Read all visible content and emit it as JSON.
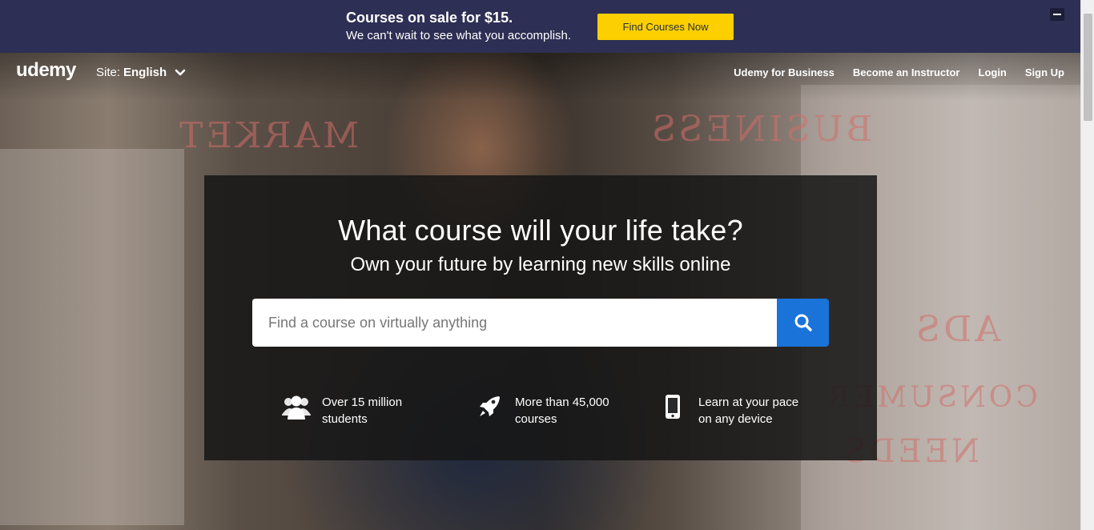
{
  "promo": {
    "title": "Courses on sale for $15.",
    "subtitle": "We can't wait to see what you accomplish.",
    "button_label": "Find Courses Now"
  },
  "header": {
    "logo": "udemy",
    "site_prefix": "Site:",
    "site_value": "English",
    "nav": [
      "Udemy for Business",
      "Become an Instructor",
      "Login",
      "Sign Up"
    ]
  },
  "hero": {
    "headline": "What course will your life take?",
    "subheadline": "Own your future by learning new skills online",
    "search": {
      "placeholder": "Find a course on virtually anything"
    },
    "features": [
      {
        "icon": "users-icon",
        "line1": "Over 15 million",
        "line2": "students"
      },
      {
        "icon": "rocket-icon",
        "line1": "More than 45,000",
        "line2": "courses"
      },
      {
        "icon": "mobile-icon",
        "line1": "Learn at your pace",
        "line2": "on any device"
      }
    ],
    "glass_words": [
      "MARKET",
      "BUSINESS",
      "ADS",
      "CONSUMER",
      "NEEDS"
    ]
  },
  "colors": {
    "promo_bg": "#2e2f54",
    "promo_button": "#fccf00",
    "search_button": "#1a73d8"
  }
}
